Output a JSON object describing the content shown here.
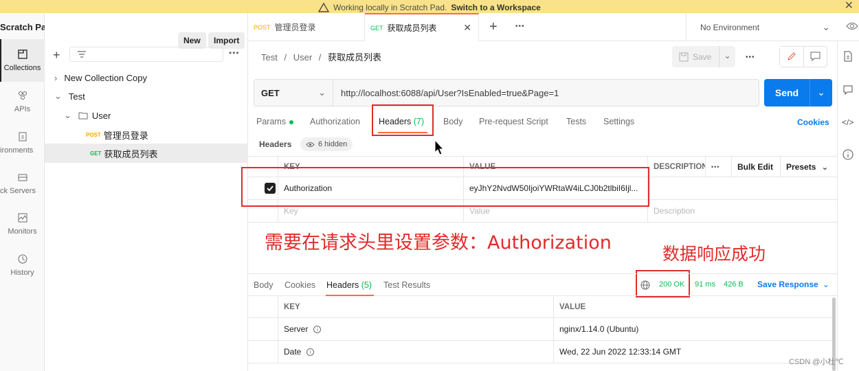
{
  "banner": {
    "text": "Working locally in Scratch Pad.",
    "link": "Switch to a Workspace",
    "icon": "warning-icon",
    "close_icon": "close-icon"
  },
  "appnav": {
    "title": "Scratch Pad",
    "items": [
      {
        "label": "Collections",
        "icon": "collections-icon"
      },
      {
        "label": "APIs",
        "icon": "apis-icon"
      },
      {
        "label": "ironments",
        "icon": "environments-icon"
      },
      {
        "label": "ck Servers",
        "icon": "mock-servers-icon"
      },
      {
        "label": "Monitors",
        "icon": "monitors-icon"
      },
      {
        "label": "History",
        "icon": "history-icon"
      }
    ]
  },
  "sidebar": {
    "new_label": "New",
    "import_label": "Import",
    "tree": [
      {
        "label": "New Collection Copy"
      },
      {
        "label": "Test"
      },
      {
        "label": "User"
      },
      {
        "method": "POST",
        "label": "管理员登录"
      },
      {
        "method": "GET",
        "label": "获取成员列表"
      }
    ]
  },
  "tabs": [
    {
      "method": "POST",
      "label": "管理员登录"
    },
    {
      "method": "GET",
      "label": "获取成员列表"
    }
  ],
  "environment": "No Environment",
  "request": {
    "breadcrumb": [
      "Test",
      "User",
      "获取成员列表"
    ],
    "save_label": "Save",
    "method": "GET",
    "url": "http://localhost:6088/api/User?IsEnabled=true&Page=1",
    "send_label": "Send",
    "tabs": {
      "params": "Params",
      "authorization": "Authorization",
      "headers": "Headers",
      "headers_count": "(7)",
      "body": "Body",
      "prerequest": "Pre-request Script",
      "tests": "Tests",
      "settings": "Settings"
    },
    "cookies_label": "Cookies",
    "headers_sub": "Headers",
    "hidden_label": "6 hidden",
    "table": {
      "col_key": "KEY",
      "col_value": "VALUE",
      "col_desc": "DESCRIPTION",
      "bulk_edit": "Bulk Edit",
      "presets": "Presets",
      "row_key": "Authorization",
      "row_value": "eyJhY2NvdW50IjoiYWRtaW4iLCJ0b2tlbiI6Ijl...",
      "ph_key": "Key",
      "ph_value": "Value",
      "ph_desc": "Description"
    }
  },
  "annotations": {
    "note1": "需要在请求头里设置参数：Authorization",
    "note2": "数据响应成功"
  },
  "response": {
    "tabs": {
      "body": "Body",
      "cookies": "Cookies",
      "headers": "Headers",
      "headers_count": "(5)",
      "test_results": "Test Results"
    },
    "status": "200 OK",
    "time": "91 ms",
    "size": "426 B",
    "save_label": "Save Response",
    "table": {
      "col_key": "KEY",
      "col_value": "VALUE",
      "rows": [
        {
          "key": "Server",
          "value": "nginx/1.14.0 (Ubuntu)"
        },
        {
          "key": "Date",
          "value": "Wed, 22 Jun 2022 12:33:14 GMT"
        }
      ]
    }
  },
  "watermark": "CSDN @小杜℃",
  "colors": {
    "accent": "#ff6c37",
    "send": "#097bed",
    "ok": "#0cbb52",
    "annotation": "#e12b2b",
    "banner": "#f9e28a"
  }
}
